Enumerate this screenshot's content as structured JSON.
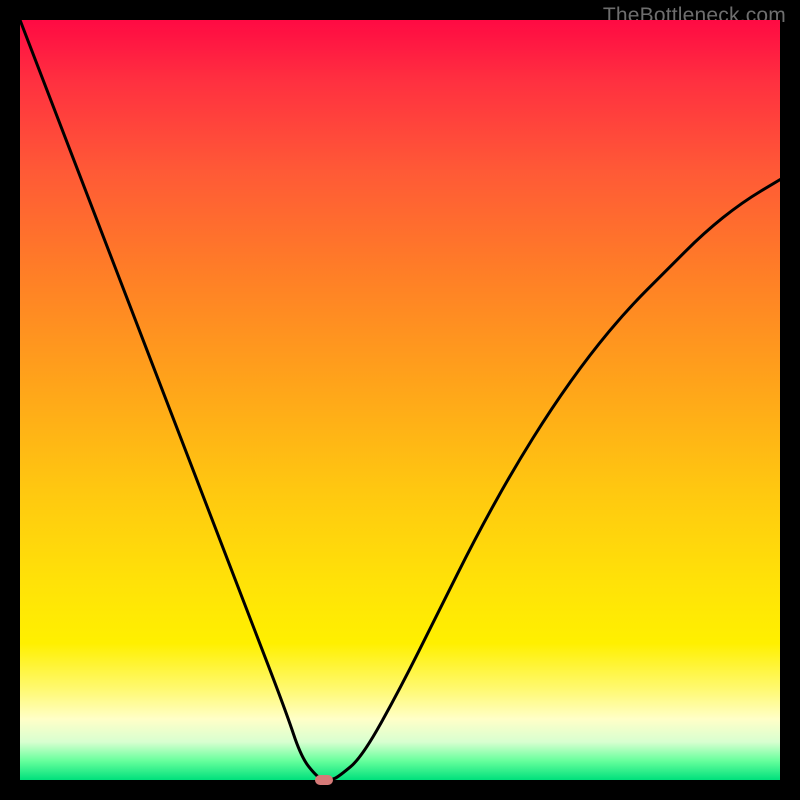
{
  "watermark": {
    "text": "TheBottleneck.com"
  },
  "chart_data": {
    "type": "line",
    "title": "",
    "xlabel": "",
    "ylabel": "",
    "xlim": [
      0,
      100
    ],
    "ylim": [
      0,
      100
    ],
    "x": [
      0,
      5,
      10,
      15,
      20,
      25,
      30,
      35,
      37,
      39,
      40,
      41,
      42,
      45,
      50,
      55,
      60,
      65,
      70,
      75,
      80,
      85,
      90,
      95,
      100
    ],
    "y": [
      100,
      87,
      74,
      61,
      48,
      35,
      22,
      9,
      3,
      0.5,
      0,
      0,
      0.5,
      3,
      12,
      22,
      32,
      41,
      49,
      56,
      62,
      67,
      72,
      76,
      79
    ],
    "minimum_x": 40,
    "background_gradient": {
      "top_color": "#ff0a43",
      "bottom_color": "#00e07c"
    },
    "marker": {
      "x": 40,
      "y": 0,
      "color": "#d67a78"
    }
  }
}
